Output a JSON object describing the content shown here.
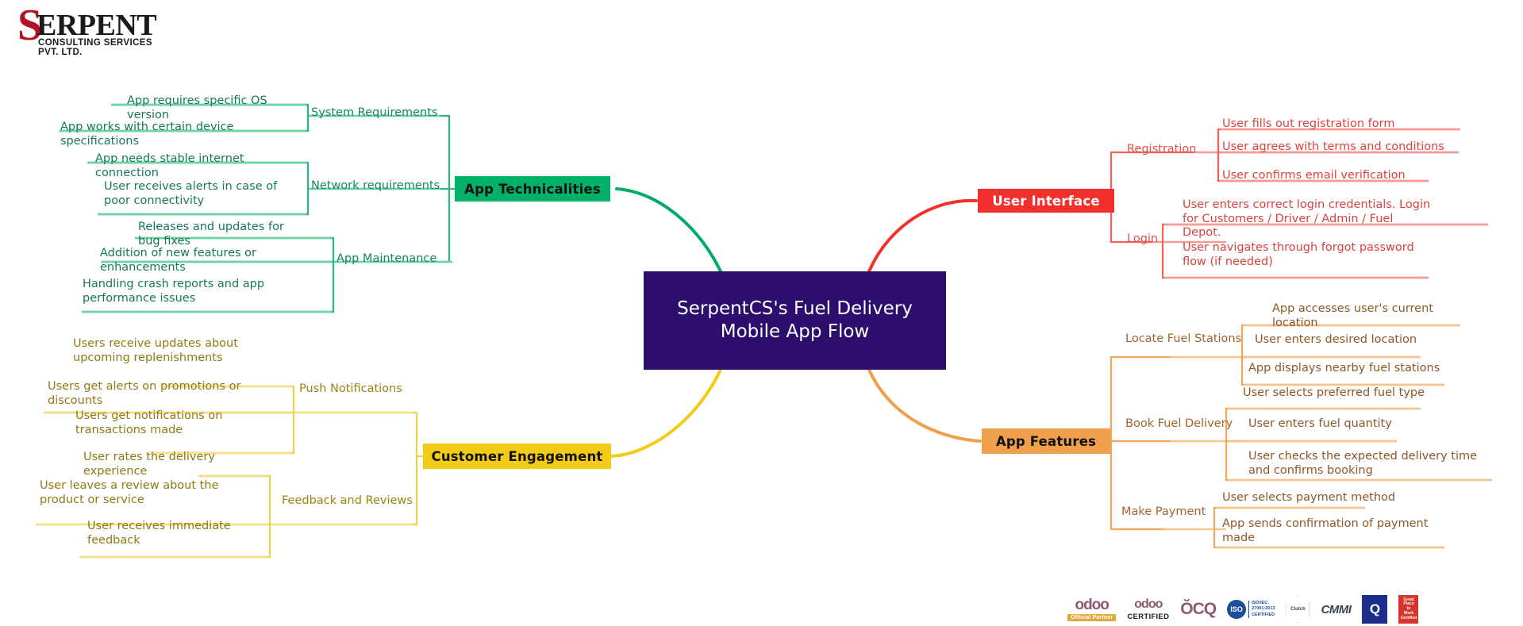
{
  "brand": {
    "logo_initial": "S",
    "logo_name": "ERPENT",
    "logo_tagline": "CONSULTING SERVICES PVT. LTD."
  },
  "center": {
    "title": "SerpentCS's Fuel Delivery Mobile App Flow",
    "color": "#2d0e6e"
  },
  "branches": [
    {
      "id": "app-technicalities",
      "label": "App Technicalities",
      "color": "#00b268",
      "position": "top-left",
      "subtopics": [
        {
          "label": "System Requirements",
          "leaves": [
            "App requires specific OS version",
            "App works with certain device specifications"
          ]
        },
        {
          "label": "Network requirements",
          "leaves": [
            "App needs stable internet connection",
            "User receives alerts in case of poor connectivity"
          ]
        },
        {
          "label": "App Maintenance",
          "leaves": [
            "Releases and updates for bug fixes",
            "Addition of new features or enhancements",
            "Handling crash reports and app performance issues"
          ]
        }
      ]
    },
    {
      "id": "user-interface",
      "label": "User Interface",
      "color": "#f4302c",
      "position": "top-right",
      "subtopics": [
        {
          "label": "Registration",
          "leaves": [
            "User fills out registration form",
            "User agrees with terms and conditions",
            "User confirms email verification"
          ]
        },
        {
          "label": "Login",
          "leaves": [
            "User enters correct login credentials. Login for Customers / Driver / Admin / Fuel Depot.",
            "User navigates through forgot password flow (if needed)"
          ]
        }
      ]
    },
    {
      "id": "customer-engagement",
      "label": "Customer Engagement",
      "color": "#f2cb17",
      "position": "bottom-left",
      "subtopics": [
        {
          "label": "Push Notifications",
          "leaves": [
            "Users receive updates about upcoming replenishments",
            "Users get alerts on promotions or discounts",
            "Users get notifications on transactions made"
          ]
        },
        {
          "label": "Feedback and Reviews",
          "leaves": [
            "User rates the delivery experience",
            "User leaves a review about the product or service",
            "User receives immediate feedback"
          ]
        }
      ]
    },
    {
      "id": "app-features",
      "label": "App Features",
      "color": "#f0a04b",
      "position": "bottom-right",
      "subtopics": [
        {
          "label": "Locate Fuel Stations",
          "leaves": [
            "App accesses user's current location",
            "User enters desired location",
            "App displays nearby fuel stations"
          ]
        },
        {
          "label": "Book Fuel Delivery",
          "leaves": [
            "User selects preferred fuel type",
            "User enters fuel quantity",
            "User checks the expected delivery time and confirms booking"
          ]
        },
        {
          "label": "Make Payment",
          "leaves": [
            "User selects payment method",
            "App sends confirmation of payment made"
          ]
        }
      ]
    }
  ],
  "nodes": {
    "b1_label": "App Technicalities",
    "b1_s1": "System Requirements",
    "b1_s1_l1": "App requires specific OS version",
    "b1_s1_l2": "App works with certain device specifications",
    "b1_s2": "Network requirements",
    "b1_s2_l1": "App needs stable internet connection",
    "b1_s2_l2": "User receives alerts in case of poor connectivity",
    "b1_s3": "App Maintenance",
    "b1_s3_l1": "Releases and updates for bug fixes",
    "b1_s3_l2": "Addition of new features or enhancements",
    "b1_s3_l3": "Handling crash reports and app performance issues",
    "b2_label": "User Interface",
    "b2_s1": "Registration",
    "b2_s1_l1": "User fills out registration form",
    "b2_s1_l2": "User agrees with terms and conditions",
    "b2_s1_l3": "User confirms email verification",
    "b2_s2": "Login",
    "b2_s2_l1": "User enters correct login credentials. Login for Customers / Driver / Admin / Fuel Depot.",
    "b2_s2_l2": "User navigates through forgot password flow (if needed)",
    "b3_label": "Customer Engagement",
    "b3_s1": "Push Notifications",
    "b3_s1_l1": "Users receive updates about upcoming replenishments",
    "b3_s1_l2": "Users get alerts on promotions or discounts",
    "b3_s1_l3": "Users get notifications on transactions made",
    "b3_s2": "Feedback and Reviews",
    "b3_s2_l1": "User rates the delivery experience",
    "b3_s2_l2": "User leaves a review about the product or service",
    "b3_s2_l3": "User receives immediate feedback",
    "b4_label": "App Features",
    "b4_s1": "Locate Fuel Stations",
    "b4_s1_l1": "App accesses user's current location",
    "b4_s1_l2": "User enters desired location",
    "b4_s1_l3": "App displays nearby fuel stations",
    "b4_s2": "Book Fuel Delivery",
    "b4_s2_l1": "User selects preferred fuel type",
    "b4_s2_l2": "User enters fuel quantity",
    "b4_s2_l3": "User checks the expected delivery time and confirms booking",
    "b4_s3": "Make Payment",
    "b4_s3_l1": "User selects payment method",
    "b4_s3_l2": "App sends confirmation of payment made"
  },
  "footer": {
    "badges": [
      {
        "name": "odoo-official-partner",
        "word": "odoo",
        "tag": "Official Partner"
      },
      {
        "name": "odoo-certified",
        "word": "odoo",
        "tag": "CERTIFIED"
      },
      {
        "name": "oca",
        "word": "ŎCQ"
      },
      {
        "name": "iso-27001",
        "word": "ISO",
        "lines": [
          "ISO/IEC",
          "27001:2013",
          "CERTIFIED"
        ]
      },
      {
        "name": "clutch",
        "word": "Clutch"
      },
      {
        "name": "cmmi",
        "word": "CMMI"
      },
      {
        "name": "sq-certification",
        "word": "Q"
      },
      {
        "name": "great-place-to-work",
        "lines": [
          "Great",
          "Place",
          "to",
          "Work",
          "Certified"
        ]
      }
    ]
  }
}
